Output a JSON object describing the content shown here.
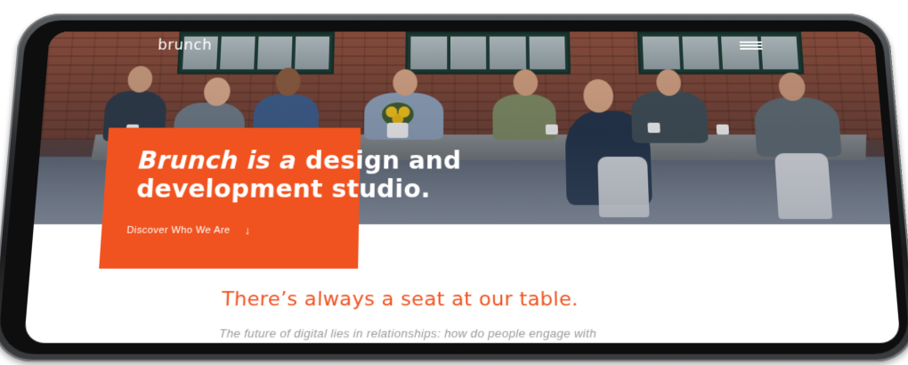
{
  "header": {
    "logo_text": "brunch",
    "menu_icon": "hamburger-menu-icon"
  },
  "hero": {
    "title_line1_italic": "Brunch is a",
    "title_line1_rest": " design and",
    "title_line2": "development studio.",
    "cta_label": "Discover Who We Are",
    "cta_icon": "arrow-down-icon",
    "cta_arrow": "↓"
  },
  "content": {
    "tagline": "There’s always a seat at our table.",
    "intro": "The future of digital lies in relationships: how do people engage with"
  },
  "colors": {
    "accent": "#f0531f",
    "body_text": "#9a9a9a",
    "white": "#ffffff"
  }
}
